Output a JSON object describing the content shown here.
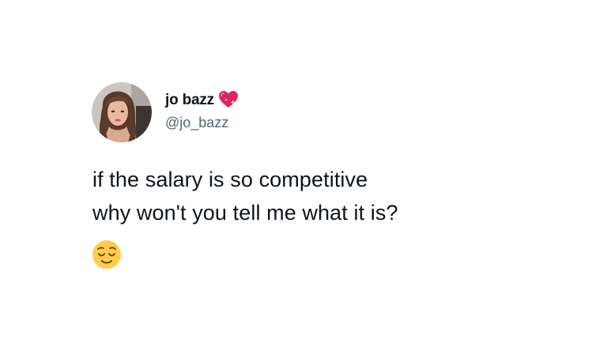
{
  "author": {
    "display_name": "jo bazz",
    "handle": "@jo_bazz",
    "badge_icon": "sparkling-heart-icon"
  },
  "tweet": {
    "lines": [
      "if the salary is so competitive",
      "why won't you tell me what it is?"
    ],
    "trailing_emoji": "relieved-face-emoji"
  },
  "colors": {
    "text": "#0f1419",
    "handle": "#536471",
    "heart": "#e0245e",
    "emoji_face": "#ffcc4d"
  }
}
